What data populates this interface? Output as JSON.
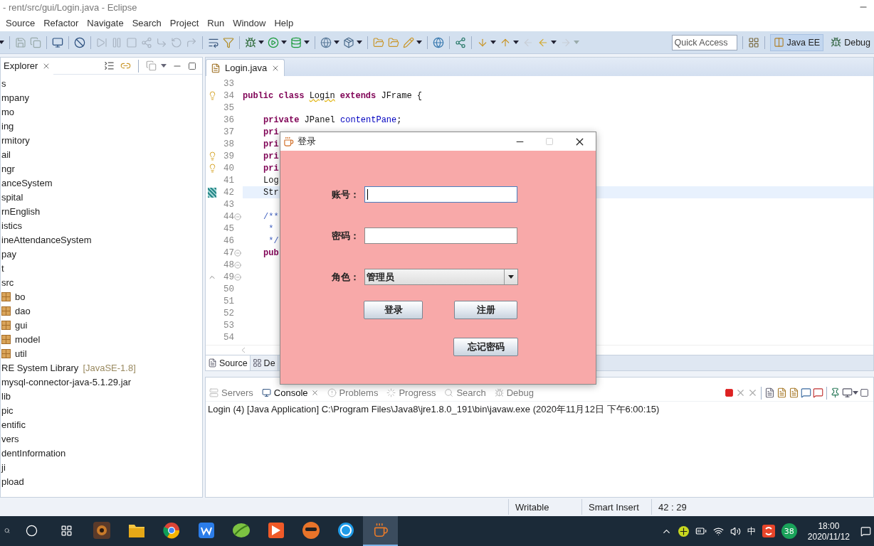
{
  "window": {
    "title": "- rent/src/gui/Login.java - Eclipse"
  },
  "menu": [
    {
      "label": "Source"
    },
    {
      "label": "Refactor"
    },
    {
      "label": "Navigate"
    },
    {
      "label": "Search"
    },
    {
      "label": "Project"
    },
    {
      "label": "Run"
    },
    {
      "label": "Window"
    },
    {
      "label": "Help"
    }
  ],
  "toolbar": {
    "quick_access": {
      "placeholder": "Quick Access"
    },
    "perspectives": [
      {
        "label": "Java EE",
        "selected": true
      },
      {
        "label": "Debug",
        "selected": false
      }
    ]
  },
  "explorer": {
    "title": "Explorer",
    "items": [
      {
        "label": "s"
      },
      {
        "label": "mpany"
      },
      {
        "label": "mo"
      },
      {
        "label": "ing"
      },
      {
        "label": "rmitory"
      },
      {
        "label": "ail"
      },
      {
        "label": "ngr"
      },
      {
        "label": "anceSystem"
      },
      {
        "label": "spital"
      },
      {
        "label": "rnEnglish"
      },
      {
        "label": "istics"
      },
      {
        "label": "ineAttendanceSystem"
      },
      {
        "label": "pay"
      },
      {
        "label": "t"
      },
      {
        "label": "src",
        "children": [
          {
            "label": "bo",
            "kind": "package"
          },
          {
            "label": "dao",
            "kind": "package"
          },
          {
            "label": "gui",
            "kind": "package"
          },
          {
            "label": "model",
            "kind": "package"
          },
          {
            "label": "util",
            "kind": "package"
          }
        ]
      },
      {
        "label": "RE System Library",
        "decoration": "[JavaSE-1.8]"
      },
      {
        "label": "mysql-connector-java-5.1.29.jar"
      },
      {
        "label": "lib"
      },
      {
        "label": "pic"
      },
      {
        "label": "entific"
      },
      {
        "label": "vers"
      },
      {
        "label": "dentInformation"
      },
      {
        "label": "ji"
      },
      {
        "label": "pload"
      }
    ]
  },
  "editor": {
    "tabs": [
      {
        "label": "Login.java",
        "selected": true
      }
    ],
    "lines": [
      {
        "number": "33",
        "current": false,
        "fold": false
      },
      {
        "number": "34",
        "current": false,
        "fold": false,
        "marker": {
          "kind": "warning"
        },
        "tokens": [
          {
            "text": "public class ",
            "kind": "keyword"
          },
          {
            "text": "Login",
            "kind": "warning"
          },
          {
            "text": " extends ",
            "kind": "keyword"
          },
          {
            "text": "JFrame {",
            "kind": "plain"
          }
        ]
      },
      {
        "number": "35",
        "current": false,
        "fold": false
      },
      {
        "number": "36",
        "current": false,
        "fold": false,
        "indented": true,
        "tokens": [
          {
            "text": "private ",
            "kind": "keyword"
          },
          {
            "text": "JPanel ",
            "kind": "plain"
          },
          {
            "text": "contentPane",
            "kind": "field"
          },
          {
            "text": ";",
            "kind": "plain"
          }
        ]
      },
      {
        "number": "37",
        "current": false,
        "fold": false,
        "indented": true,
        "tokens": [
          {
            "text": "pri",
            "kind": "keyword"
          }
        ]
      },
      {
        "number": "38",
        "current": false,
        "fold": false,
        "indented": true,
        "tokens": [
          {
            "text": "pri",
            "kind": "keyword"
          }
        ]
      },
      {
        "number": "39",
        "current": false,
        "fold": false,
        "marker": {
          "kind": "warning"
        },
        "indented": true,
        "tokens": [
          {
            "text": "pri",
            "kind": "keyword"
          }
        ]
      },
      {
        "number": "40",
        "current": false,
        "fold": false,
        "marker": {
          "kind": "warning"
        },
        "indented": true,
        "tokens": [
          {
            "text": "pri",
            "kind": "keyword"
          }
        ]
      },
      {
        "number": "41",
        "current": false,
        "fold": false,
        "indented": true,
        "tokens": [
          {
            "text": "Log",
            "kind": "plain"
          }
        ]
      },
      {
        "number": "42",
        "current": true,
        "fold": false,
        "marker": {
          "kind": "bookmark"
        },
        "indented": true,
        "tokens": [
          {
            "text": "Str",
            "kind": "plain"
          }
        ]
      },
      {
        "number": "43",
        "current": false,
        "fold": false
      },
      {
        "number": "44",
        "current": false,
        "fold": true,
        "indented": true,
        "tokens": [
          {
            "text": "/**",
            "kind": "comment"
          }
        ]
      },
      {
        "number": "45",
        "current": false,
        "fold": false,
        "indented": true,
        "tokens": [
          {
            "text": " *",
            "kind": "comment"
          }
        ]
      },
      {
        "number": "46",
        "current": false,
        "fold": false,
        "indented": true,
        "tokens": [
          {
            "text": " */",
            "kind": "comment"
          }
        ]
      },
      {
        "number": "47",
        "current": false,
        "fold": true,
        "indented": true,
        "tokens": [
          {
            "text": "pub",
            "kind": "keyword"
          }
        ]
      },
      {
        "number": "48",
        "current": false,
        "fold": true
      },
      {
        "number": "49",
        "current": false,
        "fold": true,
        "marker": {
          "kind": "triangle"
        }
      },
      {
        "number": "50",
        "current": false,
        "fold": false
      },
      {
        "number": "51",
        "current": false,
        "fold": false
      },
      {
        "number": "52",
        "current": false,
        "fold": false
      },
      {
        "number": "53",
        "current": false,
        "fold": false
      },
      {
        "number": "54",
        "current": false,
        "fold": false
      }
    ],
    "bottom_tabs": [
      {
        "label": "Source",
        "selected": true
      },
      {
        "label": "De",
        "selected": false
      }
    ]
  },
  "console": {
    "tabs": [
      {
        "label": "Servers",
        "selected": false
      },
      {
        "label": "Console",
        "selected": true
      },
      {
        "label": "Problems",
        "selected": false
      },
      {
        "label": "Progress",
        "selected": false
      },
      {
        "label": "Search",
        "selected": false
      },
      {
        "label": "Debug",
        "selected": false
      }
    ],
    "launch": "Login (4) [Java Application] C:\\Program Files\\Java8\\jre1.8.0_191\\bin\\javaw.exe (2020年11月12日 下午6:00:15)"
  },
  "status_bar": [
    "Writable",
    "Smart Insert",
    "42 : 29"
  ],
  "dialog": {
    "title": "登录",
    "fields": [
      {
        "label": "账号：",
        "kind": "text",
        "focused": true
      },
      {
        "label": "密码：",
        "kind": "password",
        "focused": false
      },
      {
        "label": "角色：",
        "kind": "combo",
        "value": "管理员"
      }
    ],
    "buttons": [
      "登录",
      "注册",
      "忘记密码"
    ]
  },
  "taskbar": {
    "apps": [
      {
        "selected": false
      },
      {
        "selected": false
      },
      {
        "selected": false
      },
      {
        "selected": false
      },
      {
        "selected": false
      },
      {
        "selected": false
      },
      {
        "selected": false
      },
      {
        "selected": false
      },
      {
        "selected": true
      }
    ],
    "tray": {
      "ime": "中",
      "badge": "38",
      "time": "18:00",
      "date": "2020/11/12"
    }
  }
}
